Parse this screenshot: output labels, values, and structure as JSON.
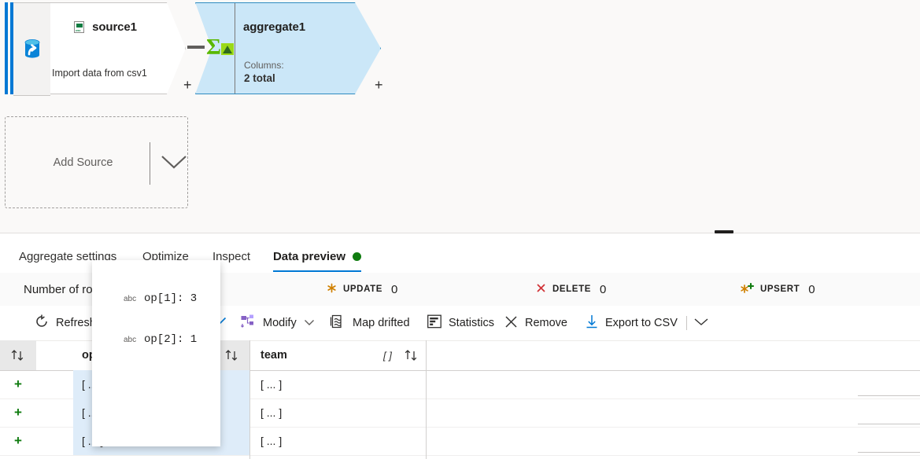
{
  "canvas": {
    "source_node": {
      "title": "source1",
      "subtitle": "Import data from csv1",
      "plus": "+",
      "doc_icon": "csv-file-icon",
      "stream_icon": "database-source-icon"
    },
    "aggregate_node": {
      "title": "aggregate1",
      "columns_label": "Columns:",
      "columns_value": "2 total",
      "plus": "+",
      "icon": "sigma-aggregate-icon"
    },
    "add_source": {
      "label": "Add Source",
      "chevron": "chevron-down-icon"
    }
  },
  "panel": {
    "collapse_handle": "panel-collapse-handle",
    "tabs": [
      {
        "label": "Aggregate settings",
        "active": false
      },
      {
        "label": "Optimize",
        "active": false
      },
      {
        "label": "Inspect",
        "active": false
      },
      {
        "label": "Data preview",
        "active": true,
        "dot": true
      }
    ],
    "status": {
      "rows_label": "Number of rows",
      "items": [
        {
          "label": "UPDATE",
          "count": "0",
          "icon": "asterisk-icon",
          "color": "#d08000"
        },
        {
          "label": "DELETE",
          "count": "0",
          "icon": "cross-icon",
          "color": "#d13438"
        },
        {
          "label": "UPSERT",
          "count": "0",
          "icon": "asterisk-plus-icon",
          "color": "#d08000"
        }
      ]
    },
    "toolbar": [
      {
        "label": "Refresh",
        "icon": "refresh-icon"
      },
      {
        "label": "",
        "icon": "checkmark-icon"
      },
      {
        "label": "Modify",
        "icon": "modify-icon",
        "chevron": "chevron-down-icon"
      },
      {
        "label": "Map drifted",
        "icon": "map-drifted-icon"
      },
      {
        "label": "Statistics",
        "icon": "statistics-icon"
      },
      {
        "label": "Remove",
        "icon": "remove-x-icon"
      },
      {
        "label": "Export to CSV",
        "icon": "download-icon"
      },
      {
        "label": "",
        "icon": "chevron-down-icon"
      }
    ],
    "grid": {
      "columns": [
        {
          "name": "op",
          "type": "",
          "sort": "sort-icon"
        },
        {
          "name": "team",
          "type": "[ ]",
          "sort": "sort-icon"
        }
      ],
      "rows": [
        {
          "marker": "+",
          "op": "[ ... ]",
          "team": "[ ... ]"
        },
        {
          "marker": "+",
          "op": "[ ... ]",
          "team": "[ ... ]"
        },
        {
          "marker": "+",
          "op": "[ ... ]",
          "team": "[ ... ]"
        }
      ]
    }
  },
  "popup": {
    "entries": [
      {
        "type": "abc",
        "expr": "op[1]: 3"
      },
      {
        "type": "abc",
        "expr": "op[2]: 1"
      }
    ]
  }
}
